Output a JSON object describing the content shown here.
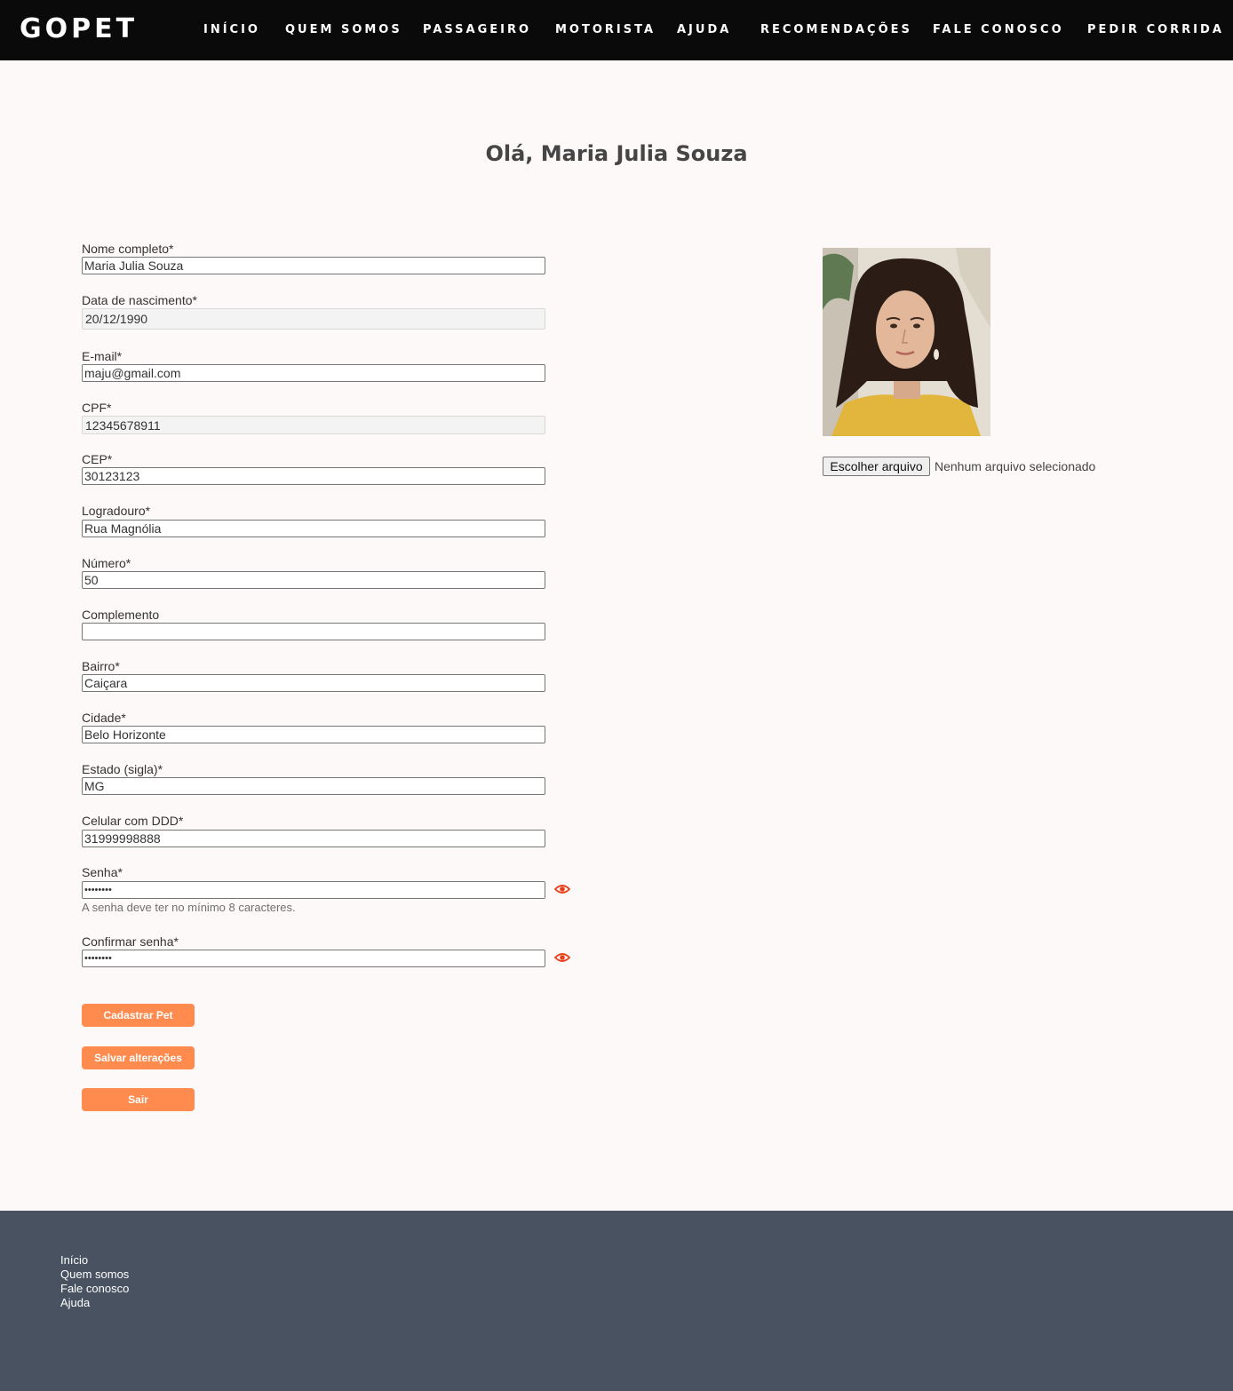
{
  "header": {
    "logo": "GOPET",
    "nav": [
      "INÍCIO",
      "QUEM SOMOS",
      "PASSAGEIRO",
      "MOTORISTA",
      "AJUDA",
      "RECOMENDAÇÕES",
      "FALE CONOSCO",
      "PEDIR CORRIDA"
    ]
  },
  "greeting": "Olá, Maria Julia Souza",
  "form": {
    "nome": {
      "label": "Nome completo*",
      "value": "Maria Julia Souza"
    },
    "nascimento": {
      "label": "Data de nascimento*",
      "value": "20/12/1990"
    },
    "email": {
      "label": "E-mail*",
      "value": "maju@gmail.com"
    },
    "cpf": {
      "label": "CPF*",
      "value": "12345678911"
    },
    "cep": {
      "label": "CEP*",
      "value": "30123123"
    },
    "logradouro": {
      "label": "Logradouro*",
      "value": "Rua Magnólia"
    },
    "numero": {
      "label": "Número*",
      "value": "50"
    },
    "complemento": {
      "label": "Complemento",
      "value": ""
    },
    "bairro": {
      "label": "Bairro*",
      "value": "Caiçara"
    },
    "cidade": {
      "label": "Cidade*",
      "value": "Belo Horizonte"
    },
    "estado": {
      "label": "Estado (sigla)*",
      "value": "MG"
    },
    "celular": {
      "label": "Celular com DDD*",
      "value": "31999998888"
    },
    "senha": {
      "label": "Senha*",
      "value": "••••••••",
      "hint": "A senha deve ter no mínimo 8 caracteres."
    },
    "confirmar": {
      "label": "Confirmar senha*",
      "value": "••••••••"
    }
  },
  "buttons": {
    "pet": "Cadastrar Pet",
    "save": "Salvar alterações",
    "logout": "Sair"
  },
  "photo": {
    "file_button": "Escolher arquivo",
    "file_status": "Nenhum arquivo selecionado"
  },
  "footer": {
    "links": [
      "Início",
      "Quem somos",
      "Fale conosco",
      "Ajuda"
    ]
  },
  "colors": {
    "accent": "#ff8b4f",
    "eye_icon": "#e8401c",
    "header_bg": "#0a0a0a",
    "footer_bg": "#485260"
  }
}
